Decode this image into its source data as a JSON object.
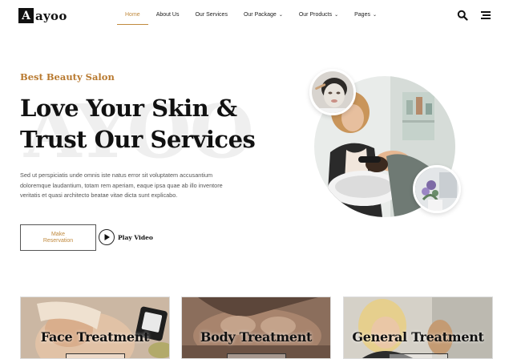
{
  "brand": {
    "mark": "A",
    "name": "ayoo"
  },
  "nav": {
    "items": [
      {
        "label": "Home",
        "active": true,
        "dropdown": false
      },
      {
        "label": "About Us",
        "active": false,
        "dropdown": false
      },
      {
        "label": "Our Services",
        "active": false,
        "dropdown": false
      },
      {
        "label": "Our Package",
        "active": false,
        "dropdown": true
      },
      {
        "label": "Our Products",
        "active": false,
        "dropdown": true
      },
      {
        "label": "Pages",
        "active": false,
        "dropdown": true
      }
    ],
    "icons": [
      "search-icon",
      "menu-icon"
    ]
  },
  "hero": {
    "watermark": "AYOO",
    "eyebrow": "Best Beauty Salon",
    "title_line1": "Love Your Skin &",
    "title_line2": "Trust Our Services",
    "description": "Sed ut perspiciatis unde omnis iste natus error sit voluptatem accusantium doloremque laudantium, totam rem aperiam, eaque ipsa quae ab illo inventore veritatis et quasi architecto beatae vitae dicta sunt explicabo.",
    "reserve_line1": "Make",
    "reserve_line2": "Reservation",
    "play_label": "Play Video"
  },
  "cards": [
    {
      "title": "Face Treatment"
    },
    {
      "title": "Body Treatment"
    },
    {
      "title": "General Treatment"
    }
  ],
  "colors": {
    "accent": "#c08a3e",
    "eyebrow": "#b8792f",
    "text": "#111111"
  }
}
